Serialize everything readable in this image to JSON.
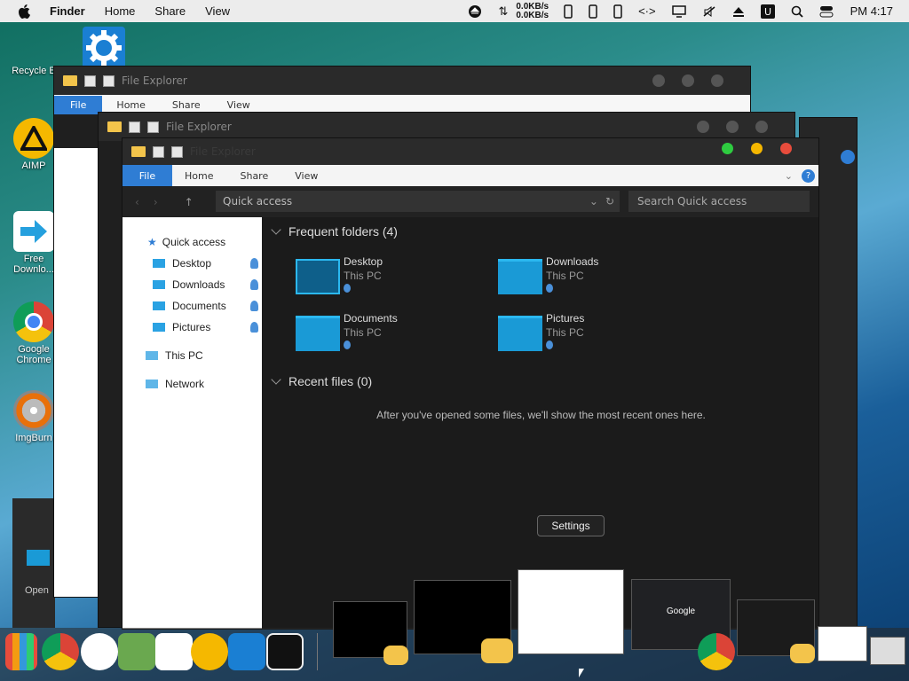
{
  "menubar": {
    "app": "Finder",
    "items": [
      "Home",
      "Share",
      "View"
    ],
    "net_up": "0.0KB/s",
    "net_down": "0.0KB/s",
    "clock": "PM 4:17"
  },
  "desktop": {
    "icons": [
      {
        "label": "Recycle B"
      },
      {
        "label": "AIMP"
      },
      {
        "label": "Free Downlo..."
      },
      {
        "label": "Google Chrome"
      },
      {
        "label": "ImgBurn"
      },
      {
        "label": "Open"
      }
    ]
  },
  "back_window": {
    "title": "File Explorer",
    "menu": {
      "file": "File",
      "home": "Home",
      "share": "Share",
      "view": "View"
    }
  },
  "mid_window": {
    "title": "File Explorer"
  },
  "front_window": {
    "title": "File Explorer",
    "menu": {
      "file": "File",
      "home": "Home",
      "share": "Share",
      "view": "View"
    },
    "address": "Quick access",
    "search_placeholder": "Search Quick access",
    "nav": {
      "quick_access": "Quick access",
      "desktop": "Desktop",
      "downloads": "Downloads",
      "documents": "Documents",
      "pictures": "Pictures",
      "this_pc": "This PC",
      "network": "Network"
    },
    "frequent": {
      "heading": "Frequent folders (4)",
      "folders": [
        {
          "name": "Desktop",
          "location": "This PC"
        },
        {
          "name": "Downloads",
          "location": "This PC"
        },
        {
          "name": "Documents",
          "location": "This PC"
        },
        {
          "name": "Pictures",
          "location": "This PC"
        }
      ]
    },
    "recent": {
      "heading": "Recent files (0)",
      "empty_message": "After you've opened some files, we'll show the most recent ones here."
    }
  },
  "tooltip": "Settings",
  "dock": {
    "thumb_google_label": "Google"
  },
  "colors": {
    "accent": "#2f7dd4",
    "folder": "#1a9ad6",
    "close": "#e74c3c",
    "minimize": "#f5b700",
    "zoom": "#2ecc40"
  }
}
